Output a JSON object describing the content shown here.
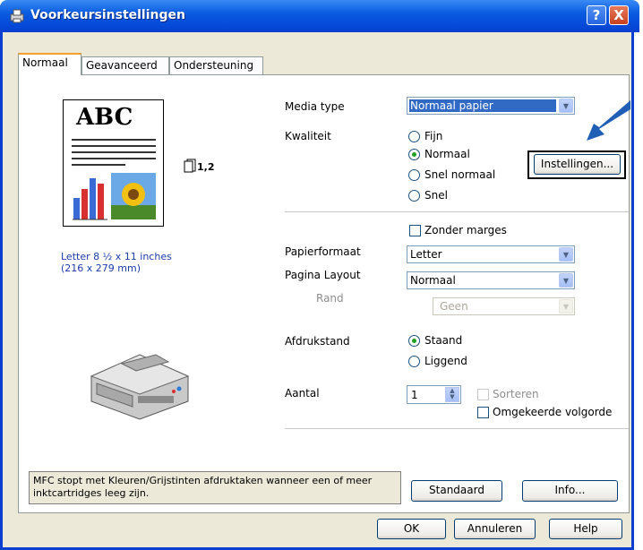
{
  "window": {
    "title": "Voorkeursinstellingen",
    "help_button": "?",
    "close_button": "X"
  },
  "tabs": [
    {
      "label": "Normaal"
    },
    {
      "label": "Geavanceerd"
    },
    {
      "label": "Ondersteuning"
    }
  ],
  "preview": {
    "doc_text": "ABC",
    "copies_indicator": "1,2",
    "paper_size_line1": "Letter 8 ½ x 11 inches",
    "paper_size_line2": "(216 x 279 mm)"
  },
  "settings": {
    "media_type_label": "Media type",
    "media_type_value": "Normaal papier",
    "quality_label": "Kwaliteit",
    "quality_options": [
      {
        "label": "Fijn",
        "selected": false
      },
      {
        "label": "Normaal",
        "selected": true
      },
      {
        "label": "Snel normaal",
        "selected": false
      },
      {
        "label": "Snel",
        "selected": false
      }
    ],
    "settings_button": "Instellingen...",
    "borderless_label": "Zonder marges",
    "paper_size_label": "Papierformaat",
    "paper_size_value": "Letter",
    "page_layout_label": "Pagina Layout",
    "page_layout_value": "Normaal",
    "border_label": "Rand",
    "border_value": "Geen",
    "orientation_label": "Afdrukstand",
    "orientation_options": [
      {
        "label": "Staand",
        "selected": true
      },
      {
        "label": "Liggend",
        "selected": false
      }
    ],
    "copies_label": "Aantal",
    "copies_value": "1",
    "collate_label": "Sorteren",
    "reverse_order_label": "Omgekeerde volgorde"
  },
  "status_text": "MFC stopt met Kleuren/Grijstinten afdruktaken wanneer een of meer inktcartridges leeg zijn.",
  "buttons": {
    "default": "Standaard",
    "info": "Info...",
    "ok": "OK",
    "cancel": "Annuleren",
    "help": "Help"
  },
  "colors": {
    "titlebar": "#0a5ce0",
    "accent_arrow": "#1f5fb5",
    "highlight": "#316ac5"
  }
}
